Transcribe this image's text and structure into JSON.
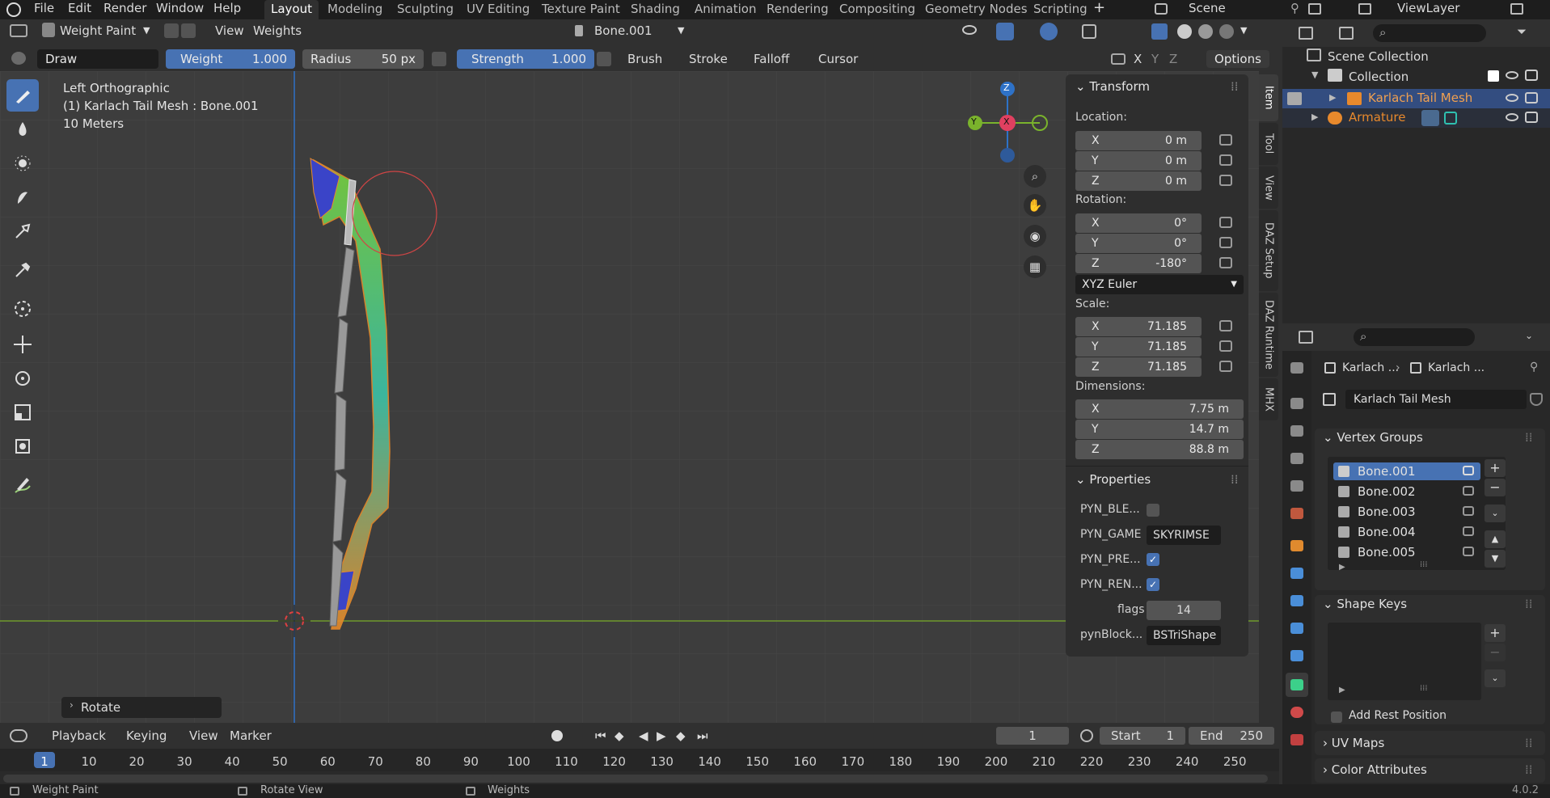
{
  "menu": {
    "items": [
      "File",
      "Edit",
      "Render",
      "Window",
      "Help"
    ],
    "workspaces": [
      "Layout",
      "Modeling",
      "Sculpting",
      "UV Editing",
      "Texture Paint",
      "Shading",
      "Animation",
      "Rendering",
      "Compositing",
      "Geometry Nodes",
      "Scripting"
    ],
    "active_workspace": "Layout",
    "scene": "Scene",
    "view_layer": "ViewLayer"
  },
  "header": {
    "mode": "Weight Paint",
    "view": "View",
    "weights": "Weights",
    "bone_selector": "Bone.001",
    "brush_name": "Draw",
    "weight_label": "Weight",
    "weight_value": "1.000",
    "radius_label": "Radius",
    "radius_value": "50 px",
    "strength_label": "Strength",
    "strength_value": "1.000",
    "brush": "Brush",
    "stroke": "Stroke",
    "falloff": "Falloff",
    "cursor": "Cursor",
    "options": "Options",
    "axis_x": "X",
    "axis_y": "Y",
    "axis_z": "Z"
  },
  "viewport": {
    "view_name": "Left Orthographic",
    "object_info": "(1) Karlach Tail Mesh : Bone.001",
    "scale": "10 Meters",
    "last_op": "Rotate",
    "gizmo": {
      "z": "Z",
      "y": "Y",
      "x": "X"
    }
  },
  "npanel": {
    "transform_title": "Transform",
    "location_label": "Location:",
    "location": [
      {
        "axis": "X",
        "value": "0 m"
      },
      {
        "axis": "Y",
        "value": "0 m"
      },
      {
        "axis": "Z",
        "value": "0 m"
      }
    ],
    "rotation_label": "Rotation:",
    "rotation": [
      {
        "axis": "X",
        "value": "0°"
      },
      {
        "axis": "Y",
        "value": "0°"
      },
      {
        "axis": "Z",
        "value": "-180°"
      }
    ],
    "rotation_mode": "XYZ Euler",
    "scale_label": "Scale:",
    "scale": [
      {
        "axis": "X",
        "value": "71.185"
      },
      {
        "axis": "Y",
        "value": "71.185"
      },
      {
        "axis": "Z",
        "value": "71.185"
      }
    ],
    "dimensions_label": "Dimensions:",
    "dimensions": [
      {
        "axis": "X",
        "value": "7.75 m"
      },
      {
        "axis": "Y",
        "value": "14.7 m"
      },
      {
        "axis": "Z",
        "value": "88.8 m"
      }
    ],
    "properties_title": "Properties",
    "props": [
      {
        "name": "PYN_BLE...",
        "value": ""
      },
      {
        "name": "PYN_GAME",
        "value": "SKYRIMSE"
      },
      {
        "name": "PYN_PRE...",
        "value": ""
      },
      {
        "name": "PYN_REN...",
        "value": ""
      },
      {
        "name": "flags",
        "value": "14"
      },
      {
        "name": "pynBlock...",
        "value": "BSTriShape"
      }
    ],
    "tabs": [
      "Item",
      "Tool",
      "View",
      "DAZ Setup",
      "DAZ Runtime",
      "MHX"
    ]
  },
  "outliner": {
    "scene_collection": "Scene Collection",
    "collection": "Collection",
    "items": [
      "Karlach Tail Mesh",
      "Armature"
    ]
  },
  "properties": {
    "breadcrumb_a": "Karlach ...",
    "breadcrumb_b": "Karlach ...",
    "mesh_name": "Karlach Tail Mesh",
    "vertex_groups_title": "Vertex Groups",
    "vertex_groups": [
      "Bone.001",
      "Bone.002",
      "Bone.003",
      "Bone.004",
      "Bone.005"
    ],
    "shape_keys_title": "Shape Keys",
    "add_rest_position": "Add Rest Position",
    "uv_maps_title": "UV Maps",
    "color_attributes_title": "Color Attributes"
  },
  "timeline": {
    "playback": "Playback",
    "keying": "Keying",
    "view": "View",
    "marker": "Marker",
    "current_frame": "1",
    "start_label": "Start",
    "start": "1",
    "end_label": "End",
    "end": "250",
    "ruler": [
      "1",
      "10",
      "20",
      "30",
      "40",
      "50",
      "60",
      "70",
      "80",
      "90",
      "100",
      "110",
      "120",
      "130",
      "140",
      "150",
      "160",
      "170",
      "180",
      "190",
      "200",
      "210",
      "220",
      "230",
      "240",
      "250"
    ]
  },
  "status": {
    "left": "Weight Paint",
    "middle": "Rotate View",
    "right": "Weights",
    "version": "4.0.2"
  },
  "colors": {
    "accent": "#4772b3",
    "orange": "#e8892c"
  }
}
